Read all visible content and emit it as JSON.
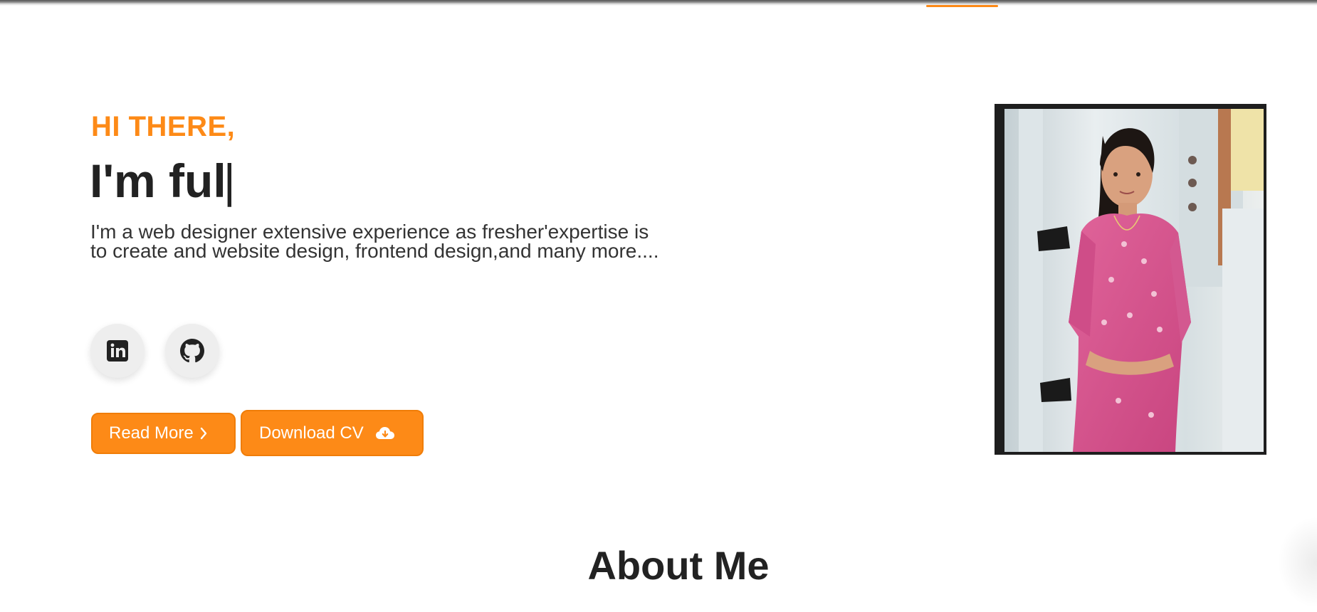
{
  "theme": {
    "accent": "#fd8a17",
    "text_dark": "#222222",
    "frame": "#1e1e1e"
  },
  "hero": {
    "greeting": "HI THERE,",
    "headline": "I'm ful",
    "cursor": "|",
    "intro": "I'm a web designer extensive experience as fresher'expertise is to create and website design, frontend design,and many more....",
    "social": [
      {
        "icon": "linkedin-icon"
      },
      {
        "icon": "github-icon"
      }
    ],
    "buttons": {
      "read_more": "Read More",
      "read_more_icon": "chevron-right-icon",
      "download_cv": "Download CV",
      "download_cv_icon": "cloud-download-icon"
    },
    "photo_icon": "profile-photo"
  },
  "about": {
    "title": "About Me"
  }
}
